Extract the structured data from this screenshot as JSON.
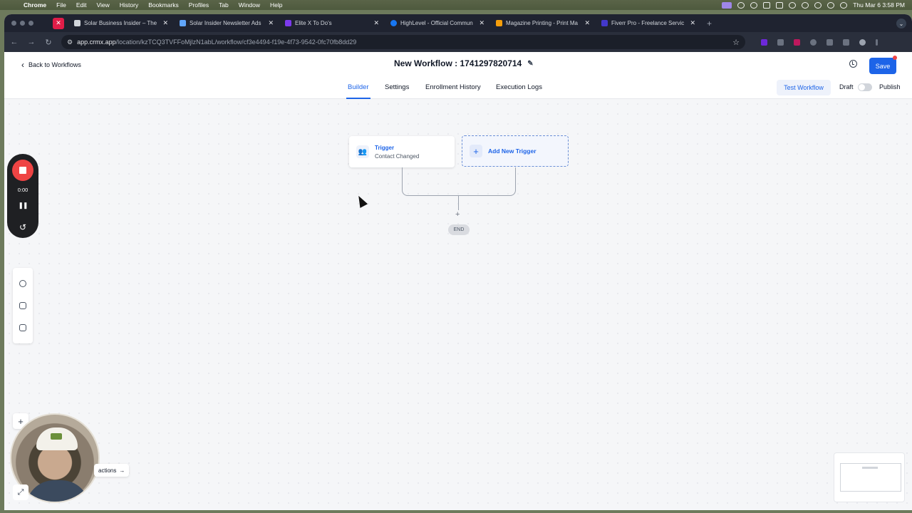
{
  "menubar": {
    "app": "Chrome",
    "items": [
      "File",
      "Edit",
      "View",
      "History",
      "Bookmarks",
      "Profiles",
      "Tab",
      "Window",
      "Help"
    ],
    "clock": "Thu Mar 6  3:58 PM"
  },
  "browser": {
    "tabs": [
      {
        "title": "Solar Business Insider – The",
        "color": "#d1d5db"
      },
      {
        "title": "Solar Insider Newsletter Ads",
        "color": "#60a5fa"
      },
      {
        "title": "Elite X To Do's",
        "color": "#7c3aed"
      },
      {
        "title": "HighLevel - Official Commun",
        "color": "#1877f2"
      },
      {
        "title": "Magazine Printing - Print Ma",
        "color": "#f59e0b"
      },
      {
        "title": "Fiverr Pro - Freelance Servic",
        "color": "#4338ca"
      }
    ],
    "url_host": "app.crmx.app",
    "url_path": "/location/kzTCQ3TVFFoMjlzN1abL/workflow/cf3e4494-f19e-4f73-9542-0fc70fb8dd29"
  },
  "header": {
    "back_label": "Back to Workflows",
    "title": "New Workflow : 1741297820714",
    "save_label": "Save",
    "accent_color": "#1d64e8"
  },
  "subnav": {
    "tabs": [
      "Builder",
      "Settings",
      "Enrollment History",
      "Execution Logs"
    ],
    "active_tab": "Builder",
    "test_label": "Test Workflow",
    "draft_label": "Draft",
    "publish_label": "Publish"
  },
  "canvas": {
    "trigger": {
      "title": "Trigger",
      "subtitle": "Contact Changed"
    },
    "add_trigger_label": "Add New Trigger",
    "end_label": "END"
  },
  "recorder": {
    "time": "0:00"
  },
  "bottom": {
    "actions_label": "actions"
  }
}
